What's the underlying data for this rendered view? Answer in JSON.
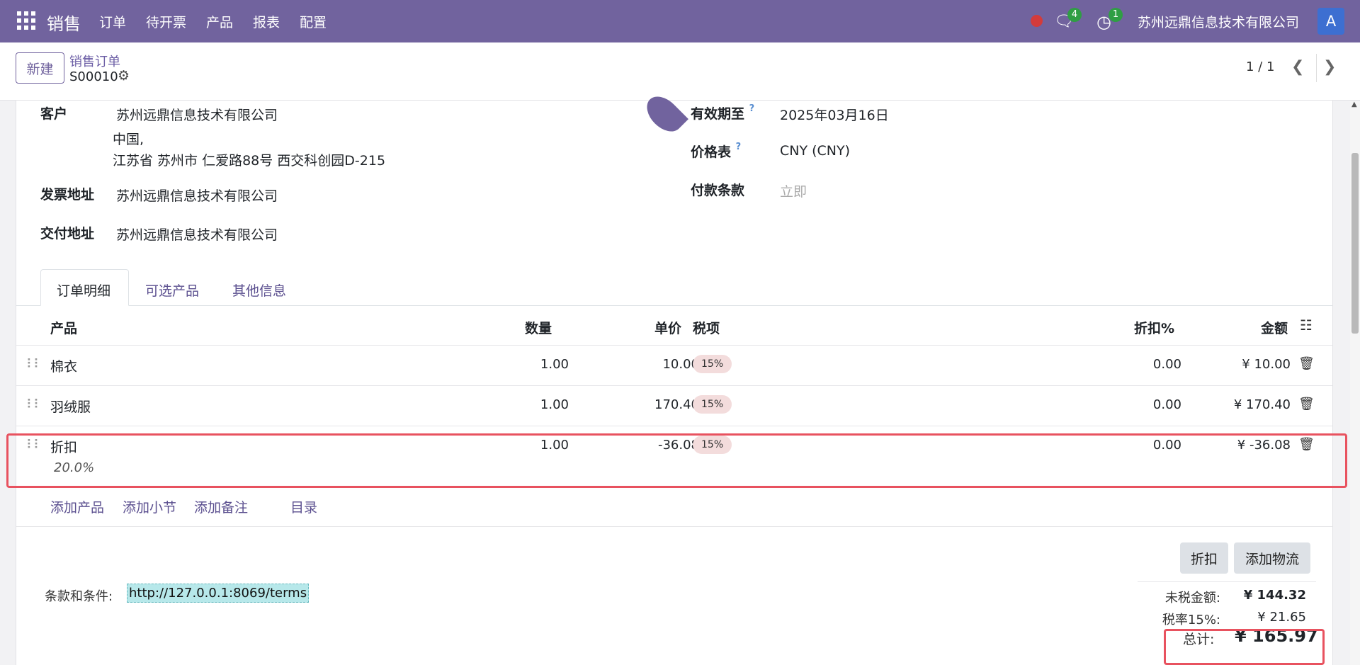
{
  "topbar": {
    "brand": "销售",
    "menu": [
      "订单",
      "待开票",
      "产品",
      "报表",
      "配置"
    ],
    "chat_badge": "4",
    "activity_badge": "1",
    "company": "苏州远鼎信息技术有限公司",
    "avatar": "A",
    "icons": [
      "apps-grid-icon",
      "recording-dot-icon",
      "chat-icon",
      "activity-clock-icon"
    ]
  },
  "control": {
    "new_label": "新建",
    "breadcrumb_parent": "销售订单",
    "record_name": "S00010",
    "pager": "1 / 1"
  },
  "form": {
    "customer_label": "客户",
    "customer_name": "苏州远鼎信息技术有限公司",
    "customer_addr_line1": "中国,",
    "customer_addr_line2": "江苏省 苏州市 仁爱路88号 西交科创园D-215",
    "invoice_label": "发票地址",
    "invoice_value": "苏州远鼎信息技术有限公司",
    "delivery_label": "交付地址",
    "delivery_value": "苏州远鼎信息技术有限公司",
    "expiry_label": "有效期至",
    "expiry_value": "2025年03月16日",
    "pricelist_label": "价格表",
    "pricelist_value": "CNY (CNY)",
    "payment_label": "付款条款",
    "payment_placeholder": "立即",
    "help_mark": "?"
  },
  "tabs": [
    {
      "label": "订单明细",
      "active": true
    },
    {
      "label": "可选产品",
      "active": false
    },
    {
      "label": "其他信息",
      "active": false
    }
  ],
  "table": {
    "headers": {
      "product": "产品",
      "qty": "数量",
      "price": "单价",
      "tax": "税项",
      "discount": "折扣%",
      "amount": "金额"
    },
    "rows": [
      {
        "product": "棉衣",
        "qty": "1.00",
        "price": "10.00",
        "tax": "15%",
        "discount": "0.00",
        "amount": "¥ 10.00"
      },
      {
        "product": "羽绒服",
        "qty": "1.00",
        "price": "170.40",
        "tax": "15%",
        "discount": "0.00",
        "amount": "¥ 170.40"
      },
      {
        "product": "折扣",
        "description": "20.0%",
        "qty": "1.00",
        "price": "-36.08",
        "tax": "15%",
        "discount": "0.00",
        "amount": "¥ -36.08"
      }
    ],
    "add_links": [
      "添加产品",
      "添加小节",
      "添加备注",
      "目录"
    ]
  },
  "footer": {
    "discount_button": "折扣",
    "shipping_button": "添加物流",
    "terms_label": "条款和条件:",
    "terms_link": "http://127.0.0.1:8069/terms",
    "untaxed_label": "未税金额:",
    "untaxed_value": "¥ 144.32",
    "tax_label": "税率15%:",
    "tax_value": "¥ 21.65",
    "total_label": "总计:",
    "total_value": "¥ 165.97"
  },
  "colors": {
    "brand": "#71639e",
    "highlight": "#e8525f",
    "tax_tag": "#f3dcdc"
  }
}
